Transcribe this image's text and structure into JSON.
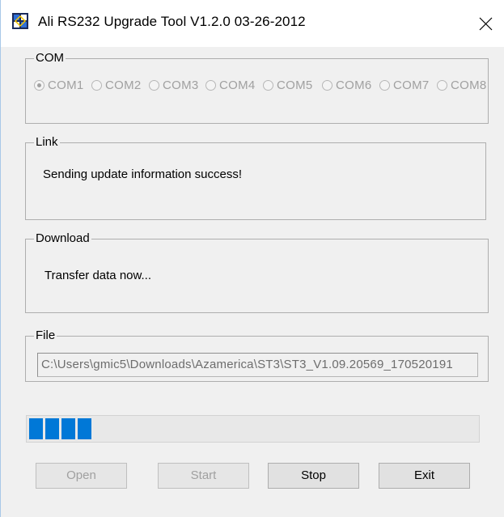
{
  "window": {
    "title": "Ali RS232 Upgrade Tool   V1.2.0  03-26-2012",
    "close_icon": "close-icon",
    "app_icon": "app-icon"
  },
  "com_group": {
    "label": "COM",
    "options": [
      {
        "label": "COM1",
        "selected": true
      },
      {
        "label": "COM2",
        "selected": false
      },
      {
        "label": "COM3",
        "selected": false
      },
      {
        "label": "COM4",
        "selected": false
      },
      {
        "label": "COM5",
        "selected": false
      },
      {
        "label": "COM6",
        "selected": false
      },
      {
        "label": "COM7",
        "selected": false
      },
      {
        "label": "COM8",
        "selected": false
      }
    ]
  },
  "link_group": {
    "label": "Link",
    "status": "Sending update information success!"
  },
  "download_group": {
    "label": "Download",
    "status": "Transfer data now..."
  },
  "file_group": {
    "label": "File",
    "path": "C:\\Users\\gmic5\\Downloads\\Azamerica\\ST3\\ST3_V1.09.20569_170520191"
  },
  "progress": {
    "segments_filled": 4,
    "color": "#0078d7"
  },
  "buttons": {
    "open": {
      "label": "Open",
      "enabled": false
    },
    "start": {
      "label": "Start",
      "enabled": false
    },
    "stop": {
      "label": "Stop",
      "enabled": true
    },
    "exit": {
      "label": "Exit",
      "enabled": true
    }
  }
}
